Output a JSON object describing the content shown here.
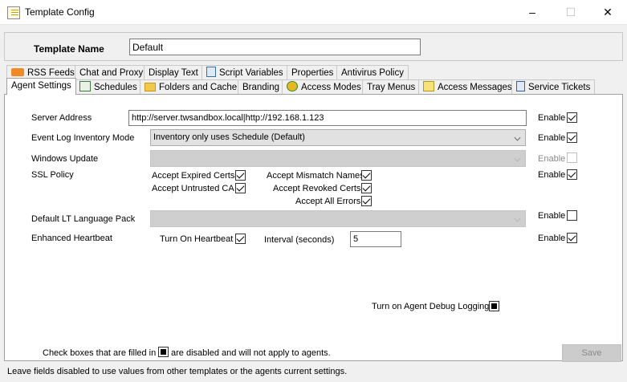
{
  "window": {
    "title": "Template Config",
    "minimize": "–",
    "maximize": "☐",
    "close": "✕"
  },
  "template_name": {
    "label": "Template Name",
    "value": "Default"
  },
  "tabs_row1": [
    {
      "label": "RSS Feeds",
      "icon": "rss-icon"
    },
    {
      "label": "Chat and Proxy"
    },
    {
      "label": "Display Text"
    },
    {
      "label": "Script Variables",
      "icon": "script-icon"
    },
    {
      "label": "Properties"
    },
    {
      "label": "Antivirus Policy"
    }
  ],
  "tabs_row2": [
    {
      "label": "Agent Settings",
      "selected": true
    },
    {
      "label": "Schedules",
      "icon": "schedule-icon"
    },
    {
      "label": "Folders and Cache",
      "icon": "folder-icon"
    },
    {
      "label": "Branding"
    },
    {
      "label": "Access Modes",
      "icon": "access-modes-icon"
    },
    {
      "label": "Tray Menus"
    },
    {
      "label": "Access Messages",
      "icon": "message-icon"
    },
    {
      "label": "Service Tickets",
      "icon": "ticket-icon"
    }
  ],
  "settings": {
    "server_address": {
      "label": "Server Address",
      "value": "http://server.twsandbox.local|http://192.168.1.123",
      "enable_label": "Enable"
    },
    "event_log": {
      "label": "Event Log Inventory Mode",
      "value": "Inventory only uses Schedule (Default)",
      "enable_label": "Enable"
    },
    "windows_update": {
      "label": "Windows Update",
      "value": "",
      "enable_label": "Enable"
    },
    "ssl_policy": {
      "label": "SSL Policy",
      "enable_label": "Enable",
      "accept_expired": "Accept Expired Certs",
      "accept_untrusted": "Accept Untrusted CA",
      "accept_mismatch": "Accept Mismatch Names",
      "accept_revoked": "Accept Revoked Certs",
      "accept_all": "Accept All Errors"
    },
    "language_pack": {
      "label": "Default LT Language Pack",
      "value": "",
      "enable_label": "Enable"
    },
    "heartbeat": {
      "label": "Enhanced Heartbeat",
      "turn_on": "Turn On Heartbeat",
      "interval_label": "Interval (seconds)",
      "interval_value": "5",
      "enable_label": "Enable"
    },
    "debug_logging": {
      "label": "Turn on Agent Debug Logging"
    }
  },
  "footer": {
    "note1_before": "Check boxes that are filled in",
    "note1_after": "are disabled and will not apply to agents.",
    "note2": "Leave fields disabled to use values from other templates or the agents current settings.",
    "save_label": "Save"
  }
}
